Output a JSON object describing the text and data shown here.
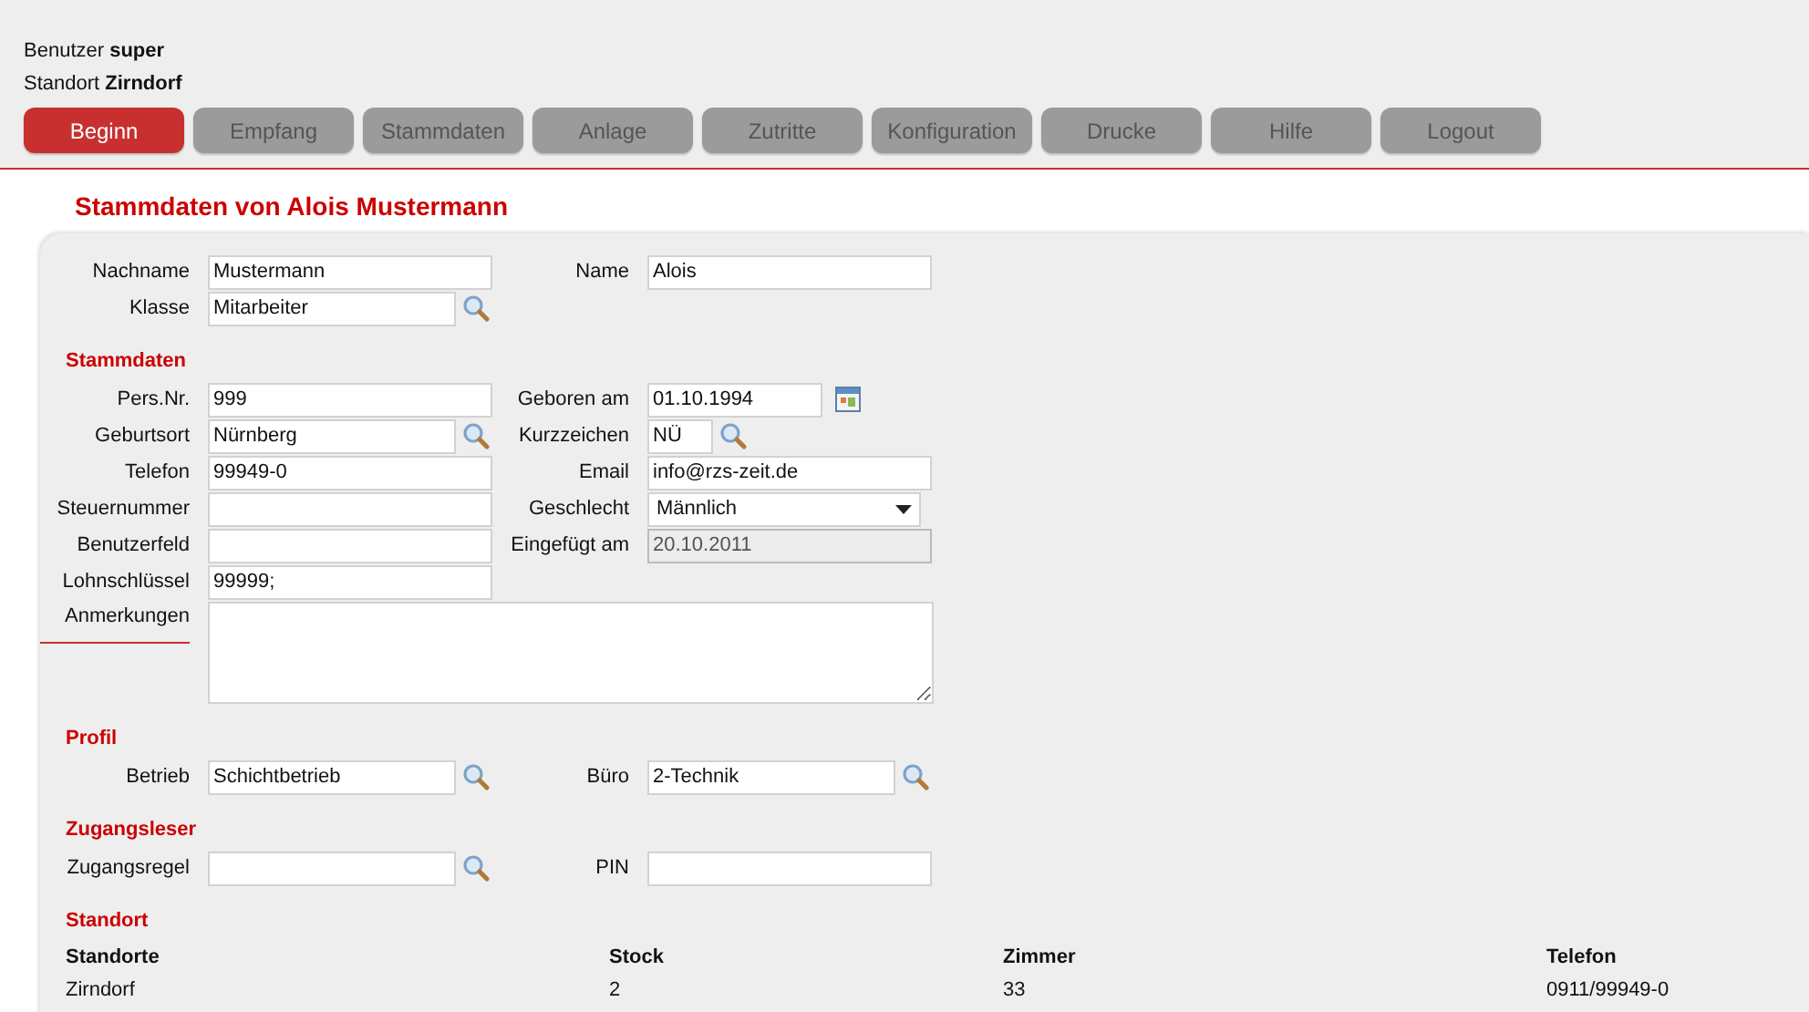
{
  "header": {
    "user": {
      "label": "Benutzer",
      "value": "super"
    },
    "location": {
      "label": "Standort",
      "value": "Zirndorf"
    }
  },
  "nav": [
    {
      "label": "Beginn",
      "selected": true
    },
    {
      "label": "Empfang",
      "selected": false
    },
    {
      "label": "Stammdaten",
      "selected": false
    },
    {
      "label": "Anlage",
      "selected": false
    },
    {
      "label": "Zutritte",
      "selected": false
    },
    {
      "label": "Konfiguration",
      "selected": false
    },
    {
      "label": "Drucke",
      "selected": false
    },
    {
      "label": "Hilfe",
      "selected": false
    },
    {
      "label": "Logout",
      "selected": false
    }
  ],
  "title": "Stammdaten von Alois Mustermann",
  "sections": [
    {
      "rows": [
        [
          {
            "label": "Nachname",
            "value": "Mustermann",
            "kind": "text"
          },
          {
            "label": "Name",
            "value": "Alois",
            "kind": "text"
          }
        ],
        [
          {
            "label": "Klasse",
            "value": "Mitarbeiter",
            "kind": "lookup"
          }
        ]
      ]
    },
    {
      "heading": "Stammdaten",
      "rows": [
        [
          {
            "label": "Pers.Nr.",
            "value": "999",
            "kind": "text"
          },
          {
            "label": "Geboren am",
            "value": "01.10.1994",
            "kind": "date"
          }
        ],
        [
          {
            "label": "Geburtsort",
            "value": "Nürnberg",
            "kind": "lookup"
          },
          {
            "label": "Kurzzeichen",
            "value": "NÜ",
            "kind": "short_lookup"
          }
        ],
        [
          {
            "label": "Telefon",
            "value": "99949-0",
            "kind": "text"
          },
          {
            "label": "Email",
            "value": "info@rzs-zeit.de",
            "kind": "text"
          }
        ],
        [
          {
            "label": "Steuernummer",
            "kind": "text"
          },
          {
            "label": "Geschlecht",
            "value": "Männlich",
            "kind": "select"
          }
        ],
        [
          {
            "label": "Benutzerfeld",
            "kind": "text"
          },
          {
            "label": "Eingefügt am",
            "value": "20.10.2011",
            "kind": "readonly"
          }
        ],
        [
          {
            "label": "Lohnschlüssel",
            "value": "99999;",
            "kind": "text"
          }
        ],
        [
          {
            "label": "Anmerkungen",
            "kind": "textarea"
          }
        ]
      ]
    },
    {
      "heading": "Profil",
      "rows": [
        [
          {
            "label": "Betrieb",
            "value": "Schichtbetrieb",
            "kind": "lookup"
          },
          {
            "label": "Büro",
            "value": "2-Technik",
            "kind": "lookup"
          }
        ]
      ]
    },
    {
      "heading": "Zugangsleser",
      "rows": [
        [
          {
            "label": "Zugangsregel",
            "kind": "lookup"
          },
          {
            "label": "PIN",
            "kind": "text"
          }
        ]
      ]
    }
  ],
  "standort": {
    "heading": "Standort",
    "table": {
      "columns": [
        "Standorte",
        "Stock",
        "Zimmer",
        "Telefon"
      ],
      "rows": [
        [
          "Zirndorf",
          "2",
          "33",
          "0911/99949-0"
        ]
      ]
    }
  }
}
